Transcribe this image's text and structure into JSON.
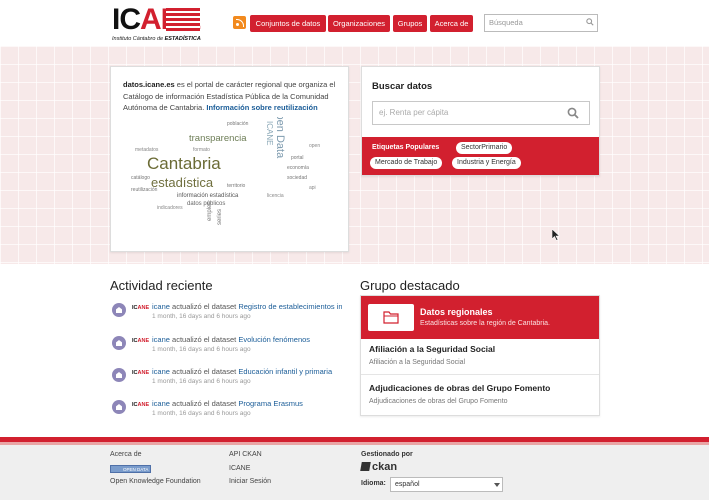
{
  "header": {
    "logo_main_black": "IC",
    "logo_main_red": "ANE",
    "logo_sub_prefix": "Instituto Cántabro de ",
    "logo_sub_bold": "ESTADÍSTICA",
    "nav": [
      {
        "label": "Conjuntos de datos"
      },
      {
        "label": "Organizaciones"
      },
      {
        "label": "Grupos"
      },
      {
        "label": "Acerca de"
      }
    ],
    "search_placeholder": "Búsqueda",
    "rss_icon": "rss-icon",
    "search_icon": "search-icon"
  },
  "intro": {
    "site": "datos.icane.es",
    "text": " es el portal de carácter regional que organiza el Catálogo de información Estadística Pública de la Comunidad Autónoma de Cantabria. ",
    "link": "Información sobre reutilización",
    "wordcloud_words": [
      "Cantabria",
      "estadística",
      "transparencia",
      "Open Data",
      "ICANE",
      "reutilización",
      "información",
      "datos",
      "catálogo",
      "portal"
    ]
  },
  "search_panel": {
    "title": "Buscar datos",
    "placeholder": "ej. Renta per cápita",
    "tags_title": "Etiquetas Populares",
    "tags": [
      "SectorPrimario",
      "Mercado de Trabajo",
      "Industria y Energía"
    ],
    "accent_color": "#d2202f"
  },
  "activity": {
    "title": "Actividad reciente",
    "logo_black": "IC",
    "logo_red": "ANE",
    "items": [
      {
        "actor": "icane",
        "verb": " actualizó el dataset ",
        "target": "Registro de establecimientos industriales",
        "meta": "1 month, 16 days and 6 hours ago"
      },
      {
        "actor": "icane",
        "verb": " actualizó el dataset ",
        "target": "Evolución fenómenos",
        "meta": "1 month, 16 days and 6 hours ago"
      },
      {
        "actor": "icane",
        "verb": " actualizó el dataset ",
        "target": "Educación infantil y primaria",
        "meta": "1 month, 16 days and 6 hours ago"
      },
      {
        "actor": "icane",
        "verb": " actualizó el dataset ",
        "target": "Programa Erasmus",
        "meta": "1 month, 16 days and 6 hours ago"
      }
    ]
  },
  "featured_group": {
    "title": "Grupo destacado",
    "name": "Datos regionales",
    "description": "Estadísticas sobre la región de Cantabria.",
    "icon": "folder-icon",
    "datasets": [
      {
        "title": "Afiliación a la Seguridad Social",
        "desc": "Afiliación a la Seguridad Social"
      },
      {
        "title": "Adjudicaciones de obras del Grupo Fomento",
        "desc": "Adjudicaciones de obras del Grupo Fomento"
      }
    ]
  },
  "footer": {
    "col1": [
      "Acerca de",
      "Open Knowledge Foundation"
    ],
    "osi_badge": "OPEN DATA",
    "col2": [
      "API CKAN",
      "ICANE",
      "Iniciar Sesión"
    ],
    "managed_by": "Gestionado por",
    "ckan": "ckan",
    "language_label": "Idioma:",
    "language_value": "español"
  }
}
